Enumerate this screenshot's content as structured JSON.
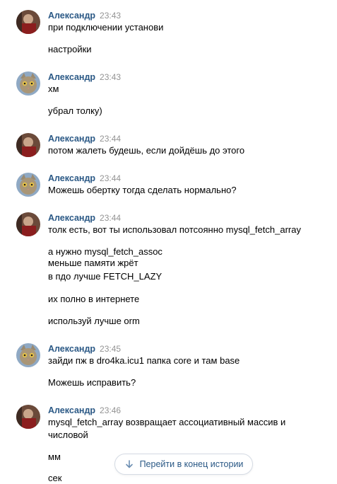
{
  "messages": [
    {
      "author": "Александр",
      "time": "23:43",
      "avatar": "avatar-photo",
      "lines": [
        "при подключении установи",
        "",
        "настройки"
      ]
    },
    {
      "author": "Александр",
      "time": "23:43",
      "avatar": "avatar-cat",
      "lines": [
        "хм",
        "",
        "убрал толку)"
      ]
    },
    {
      "author": "Александр",
      "time": "23:44",
      "avatar": "avatar-photo",
      "lines": [
        "потом жалеть будешь, если дойдёшь до этого"
      ]
    },
    {
      "author": "Александр",
      "time": "23:44",
      "avatar": "avatar-cat",
      "lines": [
        "Можешь обертку тогда сделать нормально?"
      ]
    },
    {
      "author": "Александр",
      "time": "23:44",
      "avatar": "avatar-photo",
      "lines": [
        "толк есть, вот ты использовал потсоянно mysql_fetch_array",
        "",
        "а нужно mysql_fetch_assoc",
        "меньше памяти жрёт",
        "в пдо лучше FETCH_LAZY",
        "",
        "их полно в интернете",
        "",
        "используй лучше orm"
      ]
    },
    {
      "author": "Александр",
      "time": "23:45",
      "avatar": "avatar-cat",
      "lines": [
        "зайди пж в dro4ka.icu1 папка core и там base",
        "",
        "Можешь исправить?"
      ]
    },
    {
      "author": "Александр",
      "time": "23:46",
      "avatar": "avatar-photo",
      "lines": [
        "mysql_fetch_array возвращает ассоциативный массив и",
        "числовой",
        "",
        "мм",
        "",
        "сек"
      ]
    }
  ],
  "jump_button": {
    "label": "Перейти в конец истории",
    "icon": "arrow-down-icon"
  },
  "colors": {
    "author": "#2a5885",
    "time": "#939393",
    "text": "#000000",
    "jump_text": "#2a5885"
  }
}
